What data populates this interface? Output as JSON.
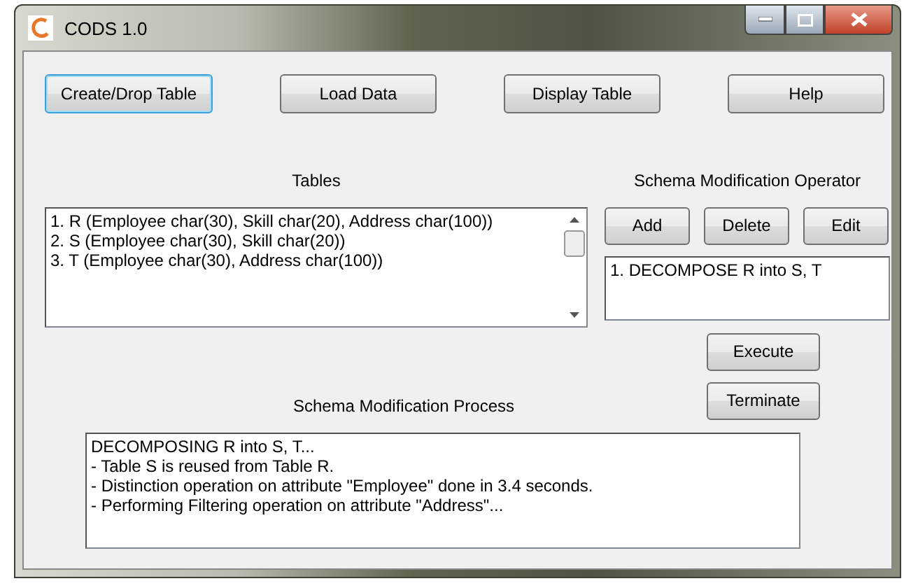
{
  "window": {
    "title": "CODS 1.0"
  },
  "toolbar": [
    {
      "label": "Create/Drop Table",
      "focused": true
    },
    {
      "label": "Load Data",
      "focused": false
    },
    {
      "label": "Display Table",
      "focused": false
    },
    {
      "label": "Help",
      "focused": false
    }
  ],
  "tables": {
    "label": "Tables",
    "items": [
      "1. R (Employee char(30), Skill char(20), Address char(100))",
      "2. S (Employee char(30), Skill char(20))",
      "3. T (Employee char(30), Address char(100))"
    ]
  },
  "operator": {
    "label": "Schema Modification Operator",
    "buttons": [
      "Add",
      "Delete",
      "Edit"
    ],
    "items": [
      "1. DECOMPOSE R into S, T"
    ]
  },
  "actions": [
    "Execute",
    "Terminate"
  ],
  "process": {
    "label": "Schema Modification Process",
    "lines": [
      "DECOMPOSING R into S, T...",
      "- Table S is reused from Table R.",
      "- Distinction operation on attribute \"Employee\" done in 3.4 seconds.",
      "- Performing Filtering operation on attribute \"Address\"..."
    ]
  }
}
